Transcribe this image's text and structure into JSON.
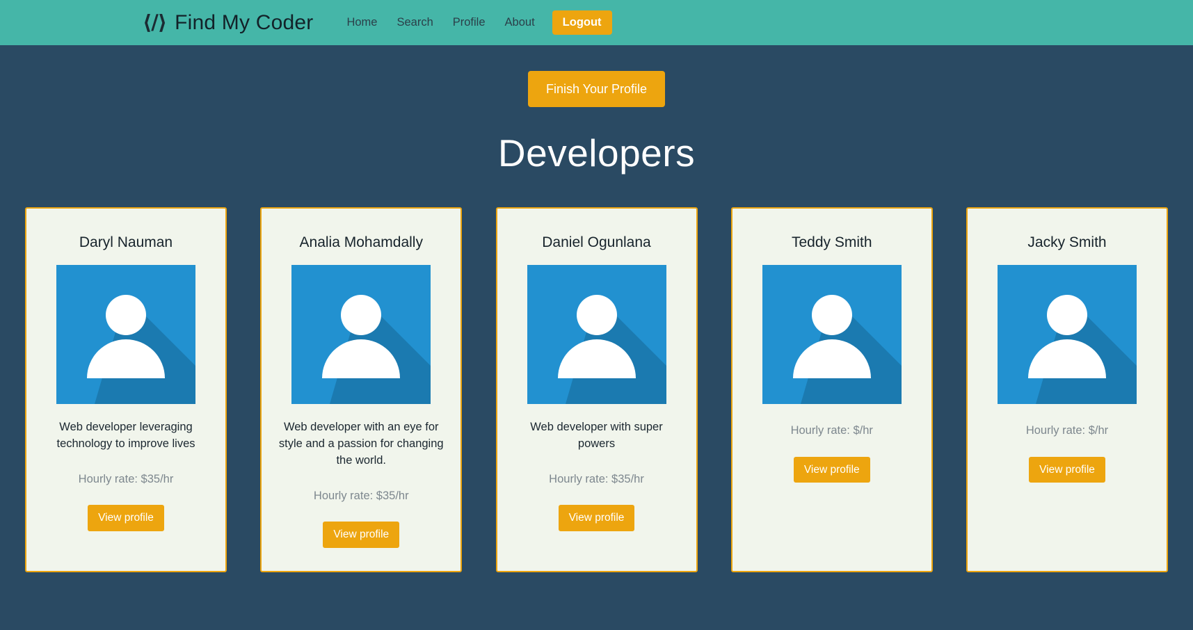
{
  "navbar": {
    "brand_icon": "code-brackets-icon",
    "brand_text": "Find My Coder",
    "links": [
      {
        "label": "Home",
        "name": "nav-link-home"
      },
      {
        "label": "Search",
        "name": "nav-link-search"
      },
      {
        "label": "Profile",
        "name": "nav-link-profile"
      },
      {
        "label": "About",
        "name": "nav-link-about"
      }
    ],
    "logout_label": "Logout",
    "background_color": "#45b6a8",
    "accent_color": "#eda50f"
  },
  "main": {
    "finish_profile_label": "Finish Your Profile",
    "page_title": "Developers",
    "background_color": "#2a4a63",
    "card_background_color": "#f1f5ec",
    "card_border_color": "#eda50f",
    "view_profile_label": "View profile"
  },
  "developers": [
    {
      "name": "Daryl Nauman",
      "bio": "Web developer leveraging technology to improve lives",
      "rate": "Hourly rate: $35/hr",
      "avatar": "user-avatar-icon",
      "button_label": "View profile"
    },
    {
      "name": "Analia Mohamdally",
      "bio": "Web developer with an eye for style and a passion for changing the world.",
      "rate": "Hourly rate: $35/hr",
      "avatar": "user-avatar-icon",
      "button_label": "View profile"
    },
    {
      "name": "Daniel Ogunlana",
      "bio": "Web developer with super powers",
      "rate": "Hourly rate: $35/hr",
      "avatar": "user-avatar-icon",
      "button_label": "View profile"
    },
    {
      "name": "Teddy Smith",
      "bio": "",
      "rate": "Hourly rate: $/hr",
      "avatar": "user-avatar-icon",
      "button_label": "View profile"
    },
    {
      "name": "Jacky Smith",
      "bio": "",
      "rate": "Hourly rate: $/hr",
      "avatar": "user-avatar-icon",
      "button_label": "View profile"
    }
  ]
}
